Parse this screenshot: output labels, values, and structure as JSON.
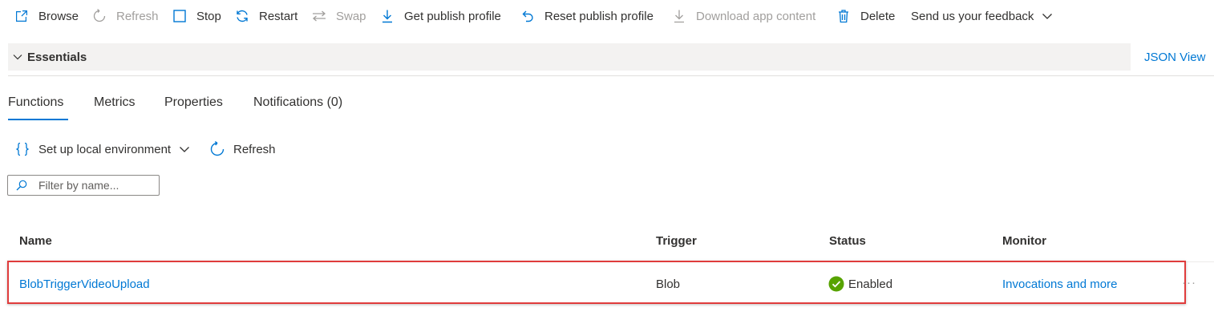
{
  "toolbar": {
    "browse": "Browse",
    "refresh": "Refresh",
    "stop": "Stop",
    "restart": "Restart",
    "swap": "Swap",
    "get_publish_profile": "Get publish profile",
    "reset_publish_profile": "Reset publish profile",
    "download_app_content": "Download app content",
    "delete": "Delete",
    "feedback": "Send us your feedback"
  },
  "essentials": {
    "title": "Essentials",
    "json_view": "JSON View"
  },
  "tabs": [
    {
      "label": "Functions",
      "active": true
    },
    {
      "label": "Metrics",
      "active": false
    },
    {
      "label": "Properties",
      "active": false
    },
    {
      "label": "Notifications (0)",
      "active": false
    }
  ],
  "commands": {
    "setup_local": "Set up local environment",
    "refresh": "Refresh"
  },
  "filter": {
    "placeholder": "Filter by name..."
  },
  "table": {
    "headers": [
      "Name",
      "Trigger",
      "Status",
      "Monitor"
    ],
    "rows": [
      {
        "name": "BlobTriggerVideoUpload",
        "trigger": "Blob",
        "status": "Enabled",
        "monitor": "Invocations and more"
      }
    ]
  },
  "colors": {
    "accent": "#0078d4",
    "success": "#57a300",
    "highlight_border": "#e03c3c"
  }
}
